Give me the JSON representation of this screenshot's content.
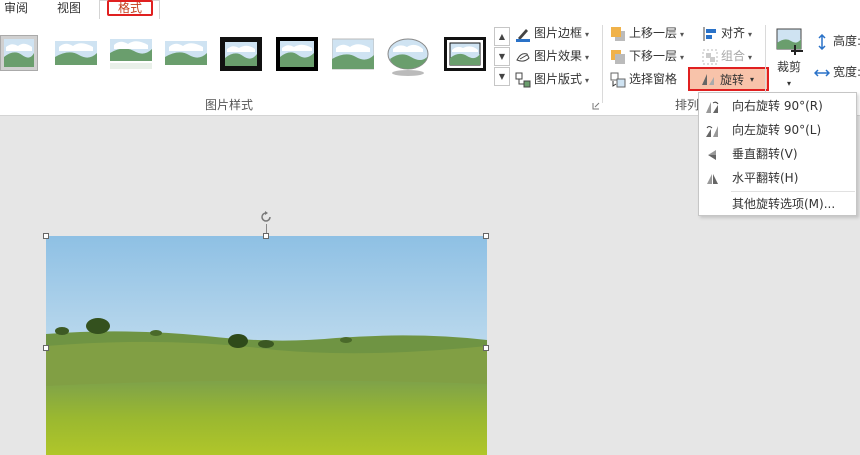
{
  "tabs": {
    "review": "审阅",
    "view": "视图",
    "format": "格式"
  },
  "picture_styles": {
    "group_label": "图片样式",
    "border": "图片边框",
    "effects": "图片效果",
    "layout": "图片版式"
  },
  "arrange": {
    "group_label": "排列",
    "bring_forward": "上移一层",
    "send_backward": "下移一层",
    "selection_pane": "选择窗格",
    "align": "对齐",
    "group": "组合",
    "rotate": "旋转"
  },
  "size": {
    "crop": "裁剪",
    "height": "高度:",
    "width": "宽度:"
  },
  "rotate_menu": [
    {
      "label": "向右旋转 90°(R)",
      "icon": "rotate-right-icon"
    },
    {
      "label": "向左旋转 90°(L)",
      "icon": "rotate-left-icon"
    },
    {
      "label": "垂直翻转(V)",
      "icon": "flip-vertical-icon"
    },
    {
      "label": "水平翻转(H)",
      "icon": "flip-horizontal-icon"
    },
    {
      "label": "其他旋转选项(M)...",
      "icon": ""
    }
  ],
  "colors": {
    "highlight": "#e02020",
    "accent_fill": "#f8c3aa"
  }
}
